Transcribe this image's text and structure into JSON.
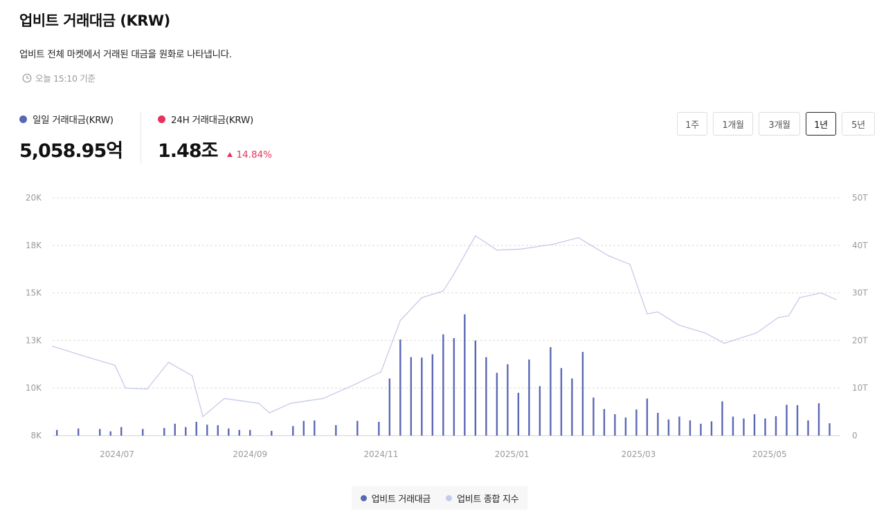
{
  "header": {
    "title": "업비트 거래대금 (KRW)",
    "subtitle": "업비트 전체 마켓에서 거래된 대금을 원화로 나타냅니다.",
    "as_of": "오늘 15:10 기준"
  },
  "stats": {
    "daily": {
      "label": "일일 거래대금(KRW)",
      "value": "5,058.95억",
      "color": "#5a67b5"
    },
    "h24": {
      "label": "24H 거래대금(KRW)",
      "value": "1.48조",
      "change": "14.84%",
      "change_color": "#e8325b",
      "color": "#e8325b"
    }
  },
  "periods": [
    {
      "label": "1주",
      "active": false
    },
    {
      "label": "1개월",
      "active": false
    },
    {
      "label": "3개월",
      "active": false
    },
    {
      "label": "1년",
      "active": true
    },
    {
      "label": "5년",
      "active": false
    }
  ],
  "legend": {
    "volume": {
      "label": "업비트 거래대금",
      "color": "#5a67b5"
    },
    "index": {
      "label": "업비트 종합 지수",
      "color": "#c5cbe8"
    }
  },
  "chart_data": {
    "type": "bar+line",
    "x_range": [
      "2024-06-01",
      "2025-06-03"
    ],
    "x_ticks": [
      "2024/07",
      "2024/09",
      "2024/11",
      "2025/01",
      "2025/03",
      "2025/05"
    ],
    "left_axis": {
      "ticks": [
        "20K",
        "18K",
        "15K",
        "13K",
        "10K",
        "8K"
      ],
      "range": [
        7500,
        20000
      ],
      "series": "업비트 종합 지수"
    },
    "right_axis": {
      "ticks": [
        "50T",
        "40T",
        "30T",
        "20T",
        "10T",
        "0"
      ],
      "range": [
        0,
        50
      ],
      "series": "업비트 거래대금"
    },
    "grid": true,
    "legend_position": "bottom-center",
    "series": [
      {
        "name": "업비트 거래대금",
        "type": "bar",
        "color": "#5a67b5",
        "points": [
          [
            "2024-06-03",
            1.2
          ],
          [
            "2024-06-13",
            1.5
          ],
          [
            "2024-06-23",
            1.4
          ],
          [
            "2024-06-28",
            0.9
          ],
          [
            "2024-07-03",
            1.8
          ],
          [
            "2024-07-13",
            1.4
          ],
          [
            "2024-07-23",
            1.6
          ],
          [
            "2024-07-28",
            2.5
          ],
          [
            "2024-08-02",
            1.8
          ],
          [
            "2024-08-07",
            2.9
          ],
          [
            "2024-08-12",
            2.3
          ],
          [
            "2024-08-17",
            2.2
          ],
          [
            "2024-08-22",
            1.5
          ],
          [
            "2024-08-27",
            1.2
          ],
          [
            "2024-09-01",
            1.2
          ],
          [
            "2024-09-11",
            1.0
          ],
          [
            "2024-09-21",
            2.0
          ],
          [
            "2024-09-26",
            3.1
          ],
          [
            "2024-10-01",
            3.2
          ],
          [
            "2024-10-11",
            2.2
          ],
          [
            "2024-10-21",
            3.1
          ],
          [
            "2024-10-31",
            2.9
          ],
          [
            "2024-11-05",
            12.0
          ],
          [
            "2024-11-10",
            20.2
          ],
          [
            "2024-11-15",
            16.5
          ],
          [
            "2024-11-20",
            16.4
          ],
          [
            "2024-11-25",
            17.1
          ],
          [
            "2024-11-30",
            21.3
          ],
          [
            "2024-12-05",
            20.5
          ],
          [
            "2024-12-10",
            25.5
          ],
          [
            "2024-12-15",
            20.0
          ],
          [
            "2024-12-20",
            16.5
          ],
          [
            "2024-12-25",
            13.2
          ],
          [
            "2024-12-30",
            15.0
          ],
          [
            "2025-01-04",
            9.0
          ],
          [
            "2025-01-09",
            16.0
          ],
          [
            "2025-01-14",
            10.4
          ],
          [
            "2025-01-19",
            18.6
          ],
          [
            "2025-01-24",
            14.2
          ],
          [
            "2025-01-29",
            12.0
          ],
          [
            "2025-02-03",
            17.6
          ],
          [
            "2025-02-08",
            8.0
          ],
          [
            "2025-02-13",
            5.6
          ],
          [
            "2025-02-18",
            4.5
          ],
          [
            "2025-02-23",
            3.8
          ],
          [
            "2025-02-28",
            5.5
          ],
          [
            "2025-03-05",
            7.8
          ],
          [
            "2025-03-10",
            4.8
          ],
          [
            "2025-03-15",
            3.4
          ],
          [
            "2025-03-20",
            4.0
          ],
          [
            "2025-03-25",
            3.2
          ],
          [
            "2025-03-30",
            2.5
          ],
          [
            "2025-04-04",
            3.0
          ],
          [
            "2025-04-09",
            7.2
          ],
          [
            "2025-04-14",
            4.0
          ],
          [
            "2025-04-19",
            3.6
          ],
          [
            "2025-04-24",
            4.5
          ],
          [
            "2025-04-29",
            3.6
          ],
          [
            "2025-05-04",
            4.1
          ],
          [
            "2025-05-09",
            6.5
          ],
          [
            "2025-05-14",
            6.4
          ],
          [
            "2025-05-19",
            3.2
          ],
          [
            "2025-05-24",
            6.8
          ],
          [
            "2025-05-29",
            2.6
          ]
        ]
      },
      {
        "name": "업비트 종합 지수",
        "type": "line",
        "color": "#c5cbe8",
        "points": [
          [
            "2024-06-01",
            12200
          ],
          [
            "2024-06-15",
            11700
          ],
          [
            "2024-06-30",
            11200
          ],
          [
            "2024-07-05",
            10000
          ],
          [
            "2024-07-15",
            9950
          ],
          [
            "2024-07-25",
            11350
          ],
          [
            "2024-08-05",
            10650
          ],
          [
            "2024-08-10",
            8500
          ],
          [
            "2024-08-20",
            9450
          ],
          [
            "2024-09-05",
            9200
          ],
          [
            "2024-09-10",
            8700
          ],
          [
            "2024-09-20",
            9200
          ],
          [
            "2024-10-05",
            9450
          ],
          [
            "2024-10-20",
            10200
          ],
          [
            "2024-11-01",
            10850
          ],
          [
            "2024-11-10",
            13550
          ],
          [
            "2024-11-20",
            14750
          ],
          [
            "2024-11-30",
            15100
          ],
          [
            "2024-12-05",
            16000
          ],
          [
            "2024-12-15",
            18000
          ],
          [
            "2024-12-25",
            17250
          ],
          [
            "2025-01-05",
            17300
          ],
          [
            "2025-01-20",
            17550
          ],
          [
            "2025-02-01",
            17900
          ],
          [
            "2025-02-15",
            16950
          ],
          [
            "2025-02-25",
            16500
          ],
          [
            "2025-03-05",
            13900
          ],
          [
            "2025-03-10",
            14000
          ],
          [
            "2025-03-20",
            13300
          ],
          [
            "2025-04-01",
            12900
          ],
          [
            "2025-04-10",
            12350
          ],
          [
            "2025-04-25",
            12900
          ],
          [
            "2025-05-05",
            13700
          ],
          [
            "2025-05-10",
            13800
          ],
          [
            "2025-05-15",
            14750
          ],
          [
            "2025-05-25",
            15000
          ],
          [
            "2025-06-01",
            14650
          ]
        ]
      }
    ]
  }
}
